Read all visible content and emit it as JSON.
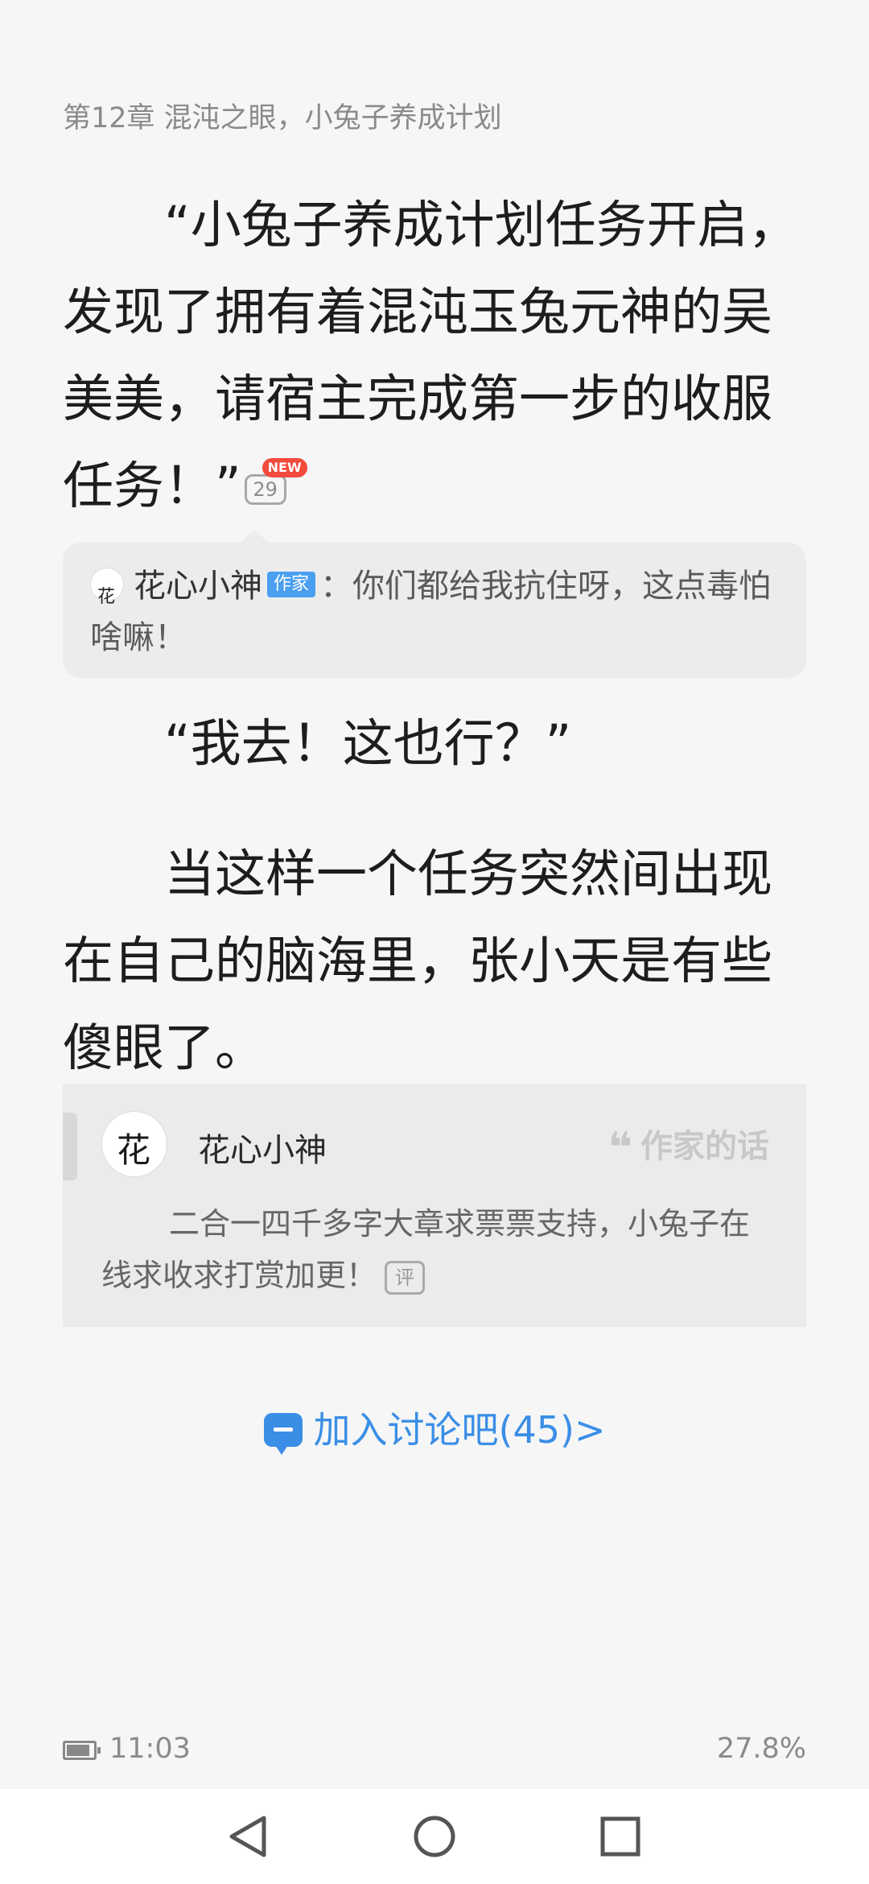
{
  "chapter": {
    "title": "第12章 混沌之眼，小兔子养成计划"
  },
  "paragraphs": {
    "p1": "“小兔子养成计划任务开启，发现了拥有着混沌玉兔元神的吴美美，请宿主完成第一步的收服任务！”",
    "p1_comment_count": "29",
    "p1_new_badge": "NEW",
    "p2": "“我去！这也行？”",
    "p3": "当这样一个任务突然间出现在自己的脑海里，张小天是有些傻眼了。"
  },
  "author_note": {
    "author": "花心小神",
    "badge": "作家",
    "separator": "：",
    "text": "你们都给我抗住呀，这点毒怕啥嘛！"
  },
  "author_words": {
    "author": "花心小神",
    "label": "作家的话",
    "message": "二合一四千多字大章求票票支持，小兔子在线求收求打赏加更！",
    "review_label": "评"
  },
  "discussion": {
    "label": "加入讨论吧(45)>"
  },
  "status": {
    "time": "11:03",
    "progress": "27.8%"
  },
  "colors": {
    "accent": "#3a8ee6",
    "badge_red": "#f24a3c",
    "author_badge": "#4a9ff0"
  }
}
